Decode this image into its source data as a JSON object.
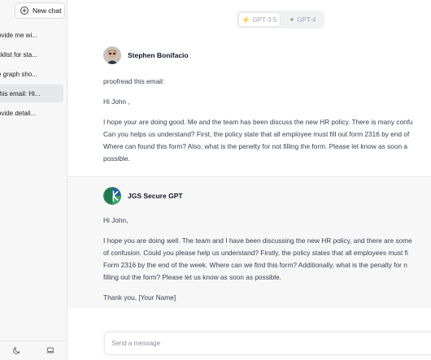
{
  "sidebar": {
    "new_chat_label": "New chat",
    "items": [
      {
        "label": "ovide me wi..."
      },
      {
        "label": "cklist for sta..."
      },
      {
        "label": "e graph sho..."
      },
      {
        "label": "this email: Hi..."
      },
      {
        "label": "ovide detail..."
      }
    ],
    "footer_icons": [
      "moon-icon",
      "laptop-icon"
    ]
  },
  "header": {
    "models": [
      {
        "label": "GPT-3.5",
        "icon": "bolt-icon",
        "selected": true
      },
      {
        "label": "GPT-4",
        "icon": "sparkle-icon",
        "selected": false
      }
    ]
  },
  "messages": {
    "user": {
      "author": "Stephen Bonifacio",
      "paragraphs": [
        [
          "proofread this email:"
        ],
        [
          "Hi John ,"
        ],
        [
          "I hope your are doing good. Me and the team has been discuss the new HR policy. There is many confu",
          "Can you helps us understand? First, the policy state that all employee must fill out form 2316 by end of",
          "Where can found this form? Also, what is the penelty for not filling the form. Please let know as soon a",
          "possible."
        ]
      ]
    },
    "bot": {
      "author": "JGS Secure GPT",
      "paragraphs": [
        [
          "Hi John,"
        ],
        [
          "I hope you are doing well. The team and I have been discussing the new HR policy, and there are some",
          "of confusion. Could you please help us understand? Firstly, the policy states that all employees must fi",
          "Form 2316 by the end of the week. Where can we find this form? Additionally, what is the penalty for n",
          "filling out the form? Please let us know as soon as possible."
        ],
        [
          "Thank you, [Your Name]"
        ]
      ]
    }
  },
  "composer": {
    "placeholder": "Send a message"
  },
  "colors": {
    "accent_green": "#1f7a4d",
    "accent_blue": "#1e5aa8",
    "gpt35_icon": "#d4a017",
    "gpt4_icon": "#7aa06a"
  }
}
